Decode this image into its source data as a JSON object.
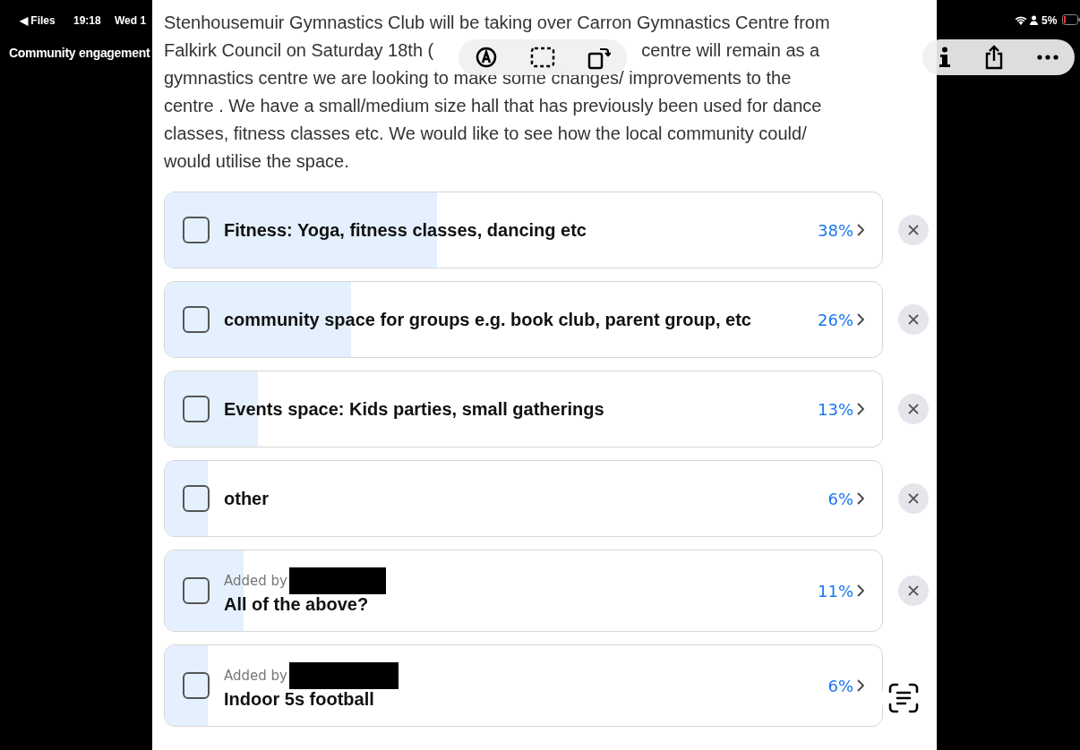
{
  "status_bar": {
    "back": "◀ Files",
    "time": "19:18",
    "date": "Wed 1",
    "battery": "5%"
  },
  "title": "Community engagement",
  "description": {
    "lines": [
      {
        "left": "Stenhousemuir Gymnastics Club will be taking over Carron Gymnastics Centre from"
      },
      {
        "left": "Falkirk Council on Saturday 18th (",
        "right": "centre will remain as a"
      },
      {
        "left": "gymnastics centre we are looking to make some changes/ improvements to the"
      },
      {
        "left": "centre . We have a small/medium size hall that has previously been used for dance"
      },
      {
        "left": "classes, fitness classes etc. We would like to see how the local community could/"
      },
      {
        "left": "would utilise the space."
      }
    ]
  },
  "options": [
    {
      "label": "Fitness: Yoga, fitness classes, dancing etc",
      "percent": "38%",
      "level": 0.38,
      "checked": false,
      "removable": true
    },
    {
      "label": "community space for groups e.g. book club, parent group, etc",
      "percent": "26%",
      "level": 0.26,
      "checked": false,
      "removable": true
    },
    {
      "label": "Events space: Kids parties, small gatherings",
      "percent": "13%",
      "level": 0.13,
      "checked": false,
      "removable": true
    },
    {
      "label": "other",
      "percent": "6%",
      "level": 0.06,
      "checked": false,
      "removable": true
    },
    {
      "label": "All of the above?",
      "added_by": "Added by",
      "percent": "11%",
      "level": 0.11,
      "checked": false,
      "removable": true
    },
    {
      "label": "Indoor 5s football",
      "added_by": "Added by",
      "percent": "6%",
      "level": 0.06,
      "checked": false,
      "removable": false
    }
  ]
}
